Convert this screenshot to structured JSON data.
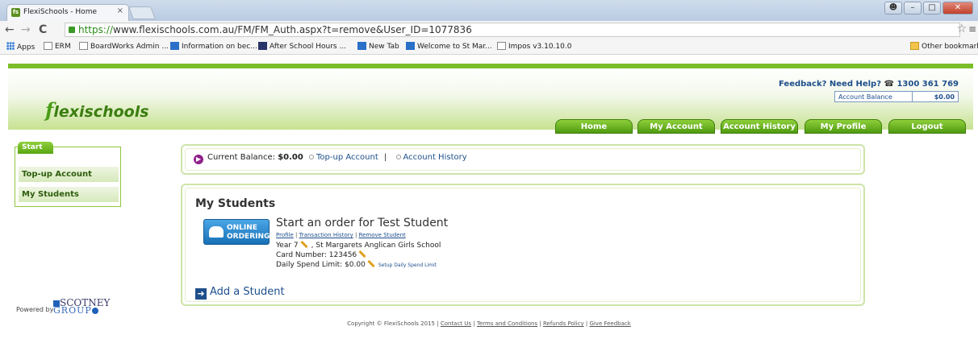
{
  "browser": {
    "tab_title": "FlexiSchools - Home",
    "tab_close": "×",
    "url_scheme": "https://",
    "url_rest": "www.flexischools.com.au/FM/FM_Auth.aspx?t=remove&User_ID=1077836",
    "bookmarks": [
      "Apps",
      "ERM",
      "BoardWorks Admin ...",
      "Information on bec...",
      "After School Hours ...",
      "New Tab",
      "Welcome to St Mar...",
      "Impos v3.10.10.0"
    ],
    "other_bookmarks": "Other bookmarks"
  },
  "header": {
    "logo_f": "f",
    "logo_rest": "lexischools",
    "help_text": "Feedback? Need Help?",
    "phone": "1300 361 769",
    "balance_label": "Account Balance",
    "balance_value": "$0.00"
  },
  "nav": {
    "home": "Home",
    "my_account": "My Account",
    "account_history": "Account History",
    "my_profile": "My Profile",
    "logout": "Logout"
  },
  "sidebar": {
    "tab": "Start",
    "items": [
      "Top-up Account",
      "My Students"
    ]
  },
  "balance_bar": {
    "label": "Current Balance:",
    "value": "$0.00",
    "topup": "Top-up Account",
    "sep": "|",
    "history": "Account History"
  },
  "students": {
    "title": "My Students",
    "button_line1": "ONLINE",
    "button_line2": "ORDERING",
    "order_text": "Start an order for Test Student",
    "links": [
      "Profile",
      "Transaction History",
      "Remove Student"
    ],
    "year": "Year 7",
    "school": ", St Margarets Anglican Girls School",
    "card_number": "Card Number: 123456",
    "daily_limit": "Daily Spend Limit: $0.00",
    "setup_limit": "Setup Daily Spend Limit",
    "add_student": "Add a Student"
  },
  "footer": {
    "powered_by": "Powered by",
    "scotney": "SCOTNEY",
    "group": "GROUP",
    "copyright": "Copyright © FlexiSchools 2015",
    "links": [
      "Contact Us",
      "Terms and Conditions",
      "Refunds Policy",
      "Give Feedback"
    ]
  }
}
